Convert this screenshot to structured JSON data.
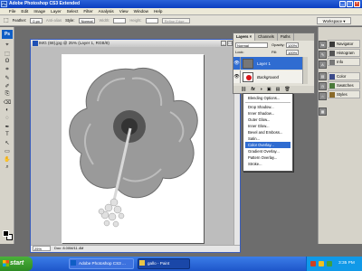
{
  "window": {
    "title": "Adobe Photoshop CS3 Extended",
    "minimize": "_",
    "maximize": "□",
    "close": "×"
  },
  "menu": [
    "File",
    "Edit",
    "Image",
    "Layer",
    "Select",
    "Filter",
    "Analysis",
    "View",
    "Window",
    "Help"
  ],
  "options_bar": {
    "feather_label": "Feather:",
    "feather_value": "0 px",
    "antialias_label": "Anti-alias",
    "style_label": "Style:",
    "style_value": "Normal",
    "width_label": "Width:",
    "height_label": "Height:",
    "refine_edge": "Refine Edge...",
    "workspace": "Workspace ▾"
  },
  "toolbox": {
    "logo": "Ps",
    "tools": [
      "⌖",
      "⬚",
      "ʘ",
      "⌗",
      "✎",
      "✐",
      "⎘",
      "⌫",
      "◐",
      "◌",
      "✒",
      "T",
      "↖",
      "▭",
      "✋",
      "⌕"
    ]
  },
  "document": {
    "title": "IMG (68).jpg @ 25% (Layer 1, RGB/8)",
    "zoom": "25%",
    "doc_size": "Doc: 8.00M/11.4M"
  },
  "layers_panel": {
    "tabs": [
      "Layers ×",
      "Channels",
      "Paths"
    ],
    "blend_mode": "Normal",
    "opacity_label": "Opacity:",
    "opacity_value": "100%",
    "lock_label": "Lock:",
    "fill_label": "Fill:",
    "fill_value": "100%",
    "layers": [
      {
        "name": "Layer 1",
        "visible_icon": "👁"
      },
      {
        "name": "Background",
        "visible_icon": "👁"
      }
    ],
    "footer_icons": [
      "⛓",
      "fx",
      "◑",
      "▣",
      "▤",
      "🗑"
    ]
  },
  "fx_menu": {
    "items": [
      "Blending Options...",
      "Drop Shadow...",
      "Inner Shadow...",
      "Outer Glow...",
      "Inner Glow...",
      "Bevel and Emboss...",
      "Satin...",
      "Color Overlay...",
      "Gradient Overlay...",
      "Pattern Overlay...",
      "Stroke..."
    ],
    "highlighted": "Color Overlay..."
  },
  "dock": {
    "panels": [
      "Navigator",
      "Histogram",
      "Info",
      "Color",
      "Swatches",
      "Styles"
    ],
    "icon_colors": [
      "#3a3a3a",
      "#555555",
      "#777777",
      "#3b4a8a",
      "#4a7a3a",
      "#8a6a2a"
    ]
  },
  "taskbar": {
    "start": "start",
    "tasks": [
      "Adobe Photoshop CS3 ...",
      "gallo - Paint"
    ],
    "clock": "3:35 PM"
  },
  "colors": {
    "accent": "#2f6cd1",
    "taskbar": "#1e56c9",
    "start_green": "#2d8a23",
    "background_layer_thumb": "#d8161a"
  }
}
